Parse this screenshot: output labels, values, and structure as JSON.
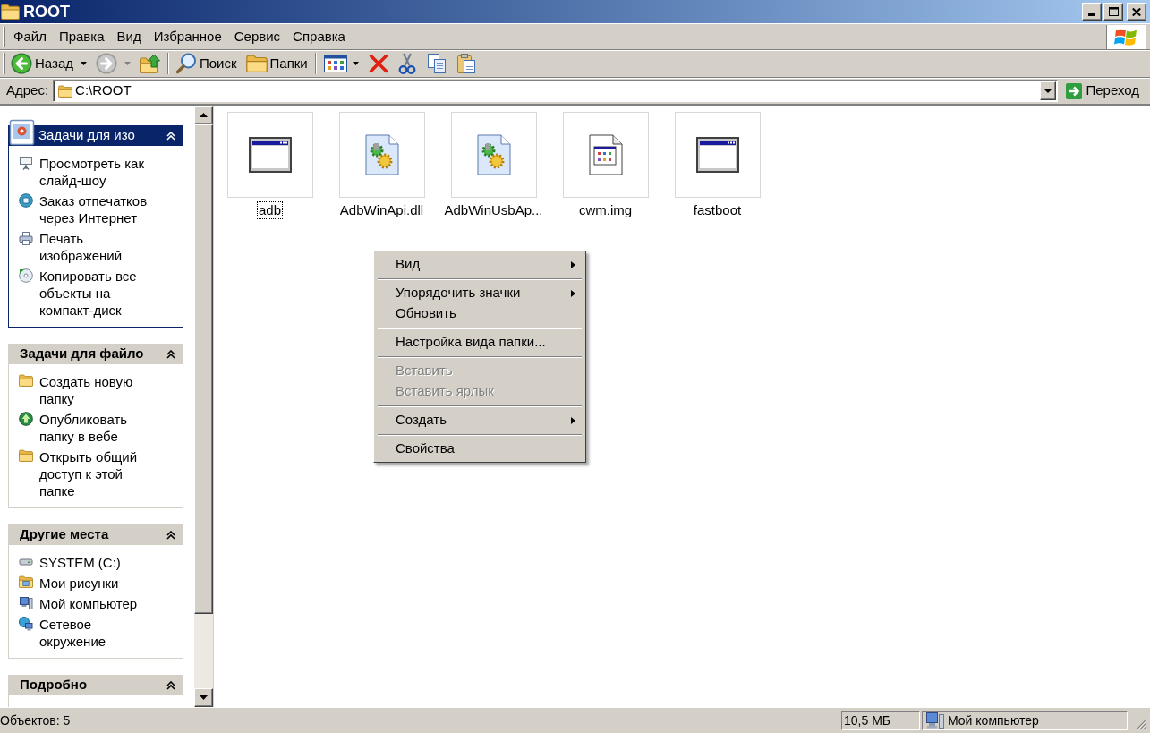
{
  "window": {
    "title": "ROOT"
  },
  "menu_bar": [
    "Файл",
    "Правка",
    "Вид",
    "Избранное",
    "Сервис",
    "Справка"
  ],
  "toolbar": {
    "back": {
      "label": "Назад",
      "disabled": false
    },
    "forward": {
      "disabled": true
    },
    "search": {
      "label": "Поиск"
    },
    "folders": {
      "label": "Папки"
    }
  },
  "address_bar": {
    "label": "Адрес:",
    "value": "C:\\ROOT",
    "go_label": "Переход"
  },
  "sidebar": {
    "panels": [
      {
        "title": "Задачи для изо",
        "kind": "special",
        "expanded": true,
        "items": [
          "Просмотреть как слайд-шоу",
          "Заказ отпечатков через Интернет",
          "Печать изображений",
          "Копировать все объекты на компакт-диск"
        ]
      },
      {
        "title": "Задачи для файло",
        "kind": "standard",
        "expanded": true,
        "items": [
          "Создать новую папку",
          "Опубликовать папку в вебе",
          "Открыть общий доступ к этой папке"
        ]
      },
      {
        "title": "Другие места",
        "kind": "standard",
        "expanded": true,
        "items": [
          "SYSTEM (C:)",
          "Мои рисунки",
          "Мой компьютер",
          "Сетевое окружение"
        ]
      },
      {
        "title": "Подробно",
        "kind": "standard",
        "expanded": true
      }
    ]
  },
  "files": [
    {
      "name": "adb",
      "kind": "application",
      "selected": false,
      "focused": true
    },
    {
      "name": "AdbWinApi.dll",
      "kind": "library",
      "selected": false,
      "focused": false
    },
    {
      "name": "AdbWinUsbAp...",
      "kind": "library",
      "selected": false,
      "focused": false
    },
    {
      "name": "cwm.img",
      "kind": "image",
      "selected": false,
      "focused": false
    },
    {
      "name": "fastboot",
      "kind": "application",
      "selected": false,
      "focused": false
    }
  ],
  "context_menu": [
    {
      "kind": "item",
      "label": "Вид",
      "submenu": true,
      "disabled": false
    },
    {
      "kind": "separator"
    },
    {
      "kind": "item",
      "label": "Упорядочить значки",
      "submenu": true,
      "disabled": false
    },
    {
      "kind": "item",
      "label": "Обновить",
      "submenu": false,
      "disabled": false
    },
    {
      "kind": "separator"
    },
    {
      "kind": "item",
      "label": "Настройка вида папки...",
      "submenu": false,
      "disabled": false
    },
    {
      "kind": "separator"
    },
    {
      "kind": "item",
      "label": "Вставить",
      "submenu": false,
      "disabled": true
    },
    {
      "kind": "item",
      "label": "Вставить ярлык",
      "submenu": false,
      "disabled": true
    },
    {
      "kind": "separator"
    },
    {
      "kind": "item",
      "label": "Создать",
      "submenu": true,
      "disabled": false
    },
    {
      "kind": "separator"
    },
    {
      "kind": "item",
      "label": "Свойства",
      "submenu": false,
      "disabled": false
    }
  ],
  "status_bar": {
    "text": "Объектов: 5",
    "size": "10,5 МБ",
    "zone": "Мой компьютер"
  }
}
